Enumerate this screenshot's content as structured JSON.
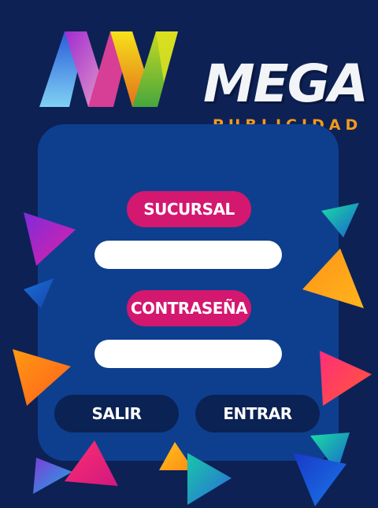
{
  "brand": {
    "word": "MEGA",
    "sub": "PUBLICIDAD",
    "accent": "#f39a1c"
  },
  "form": {
    "branch_label": "SUCURSAL",
    "branch_value": "",
    "password_label": "CONTRASEÑA",
    "password_value": ""
  },
  "actions": {
    "exit_label": "SALIR",
    "enter_label": "ENTRAR"
  },
  "colors": {
    "background": "#0d2155",
    "panel": "#0e3f8f",
    "label_pill": "#d4176f",
    "button": "#0b2254"
  }
}
